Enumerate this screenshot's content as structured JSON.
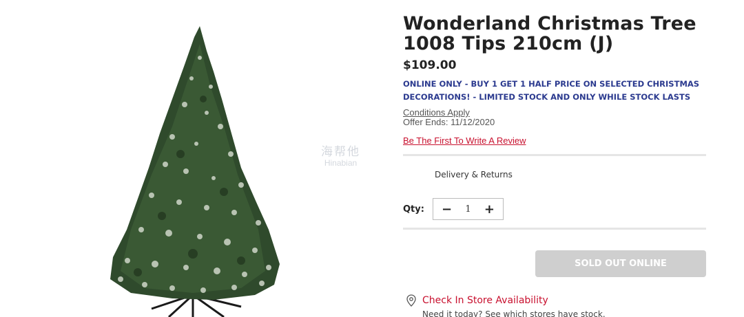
{
  "product": {
    "title": "Wonderland Christmas Tree 1008 Tips 210cm (J)",
    "price": "$109.00",
    "promo": "ONLINE ONLY - BUY 1 GET 1 HALF PRICE ON SELECTED CHRISTMAS DECORATIONS! - LIMITED STOCK AND ONLY WHILE STOCK LASTS",
    "conditions_link": "Conditions Apply",
    "offer_ends": "Offer Ends: 11/12/2020",
    "review_link": "Be The First To Write A Review",
    "image_alt": "christmas-tree-image"
  },
  "delivery": {
    "label": "Delivery & Returns"
  },
  "quantity": {
    "label": "Qty:",
    "minus": "−",
    "value": "1",
    "plus": "+"
  },
  "purchase": {
    "button_label": "SOLD OUT ONLINE",
    "button_color": "#cfcfcf"
  },
  "store": {
    "icon": "location-pin-icon",
    "title": "Check In Store Availability",
    "subtitle": "Need it today? See which stores have stock."
  },
  "watermark": {
    "main": "海帮他",
    "sub": "Hinabian"
  },
  "colors": {
    "promo": "#2b3a8f",
    "link_red": "#c8102e",
    "text": "#222222",
    "divider": "#e5e5e5"
  }
}
